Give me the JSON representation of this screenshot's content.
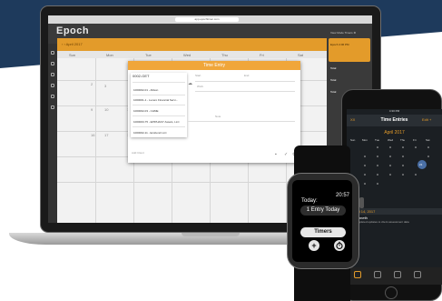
{
  "laptop": {
    "url": "app.epochtimer.com",
    "logo": "Epoch",
    "header_links": "View Mode   Timers   ⚙",
    "toolbar_text": "‹  ›   April 2017",
    "weekdays": [
      "Sun",
      "Mon",
      "Tue",
      "Wed",
      "Thu",
      "Fri",
      "Sat"
    ],
    "day_numbers": [
      "2",
      "3",
      "9",
      "10",
      "11",
      "16",
      "17",
      "18"
    ],
    "right_panel": {
      "card": "Epoch  4:06 PM",
      "rows": [
        "Total",
        "Total",
        "Total"
      ]
    },
    "modal": {
      "title": "Time Entry",
      "dropdown_selected": "0002-GET",
      "dropdown_items": [
        "1000002-01 - Allison",
        "1000001-1 - Lucero Financial Servi...",
        "1000002-03 - CHME",
        "1000003-75 - EPIPHANY Assets, LLC",
        "1000002-11 - Ecobond LLC"
      ],
      "field_labels": [
        "Start",
        "End",
        "Work",
        "Note",
        "Add Client"
      ]
    }
  },
  "phone": {
    "status": "4:30 PM",
    "nav_title": "Time Entries",
    "nav_left": "XX",
    "nav_right": "Edit  +",
    "month": "April 2017",
    "weekdays": [
      "Sun",
      "Mon",
      "Tue",
      "Wed",
      "Thu",
      "Fri",
      "Sat"
    ],
    "selected_day": "21",
    "date_header": "Fri 14, 2017",
    "entry_title": "Kenneth",
    "entry_sub": "Completed updates to client assessment data"
  },
  "watch": {
    "label": "Today:",
    "time": "20:57",
    "entries_pill": "1 Entry Today",
    "timers_button": "Timers",
    "add_icon": "plus-icon",
    "timer_icon": "timer-icon"
  }
}
